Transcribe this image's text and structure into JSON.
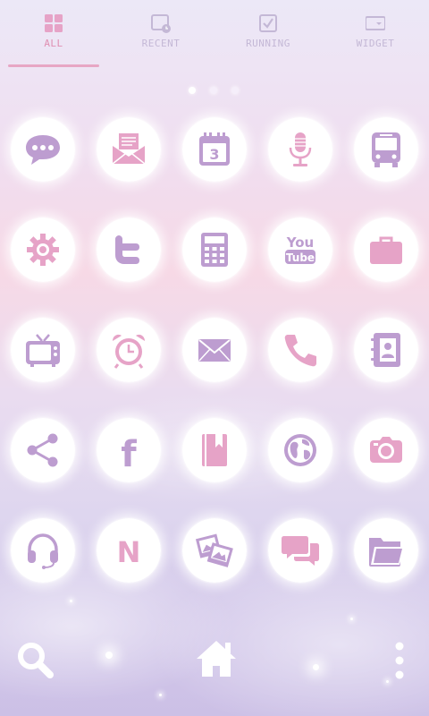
{
  "tabs": [
    {
      "label": "ALL",
      "icon": "grid-icon",
      "active": true
    },
    {
      "label": "RECENT",
      "icon": "recent-icon",
      "active": false
    },
    {
      "label": "RUNNING",
      "icon": "running-icon",
      "active": false
    },
    {
      "label": "WIDGET",
      "icon": "widget-icon",
      "active": false
    }
  ],
  "pager": {
    "pages": 3,
    "current": 1
  },
  "apps": [
    {
      "icon": "chat-bubble-icon"
    },
    {
      "icon": "mail-envelope-icon"
    },
    {
      "icon": "calendar-icon",
      "text": "3"
    },
    {
      "icon": "microphone-icon"
    },
    {
      "icon": "bus-icon"
    },
    {
      "icon": "gear-icon"
    },
    {
      "icon": "twitter-icon"
    },
    {
      "icon": "calculator-icon"
    },
    {
      "icon": "youtube-icon",
      "text": "You",
      "text2": "Tube"
    },
    {
      "icon": "briefcase-icon"
    },
    {
      "icon": "tv-icon"
    },
    {
      "icon": "alarm-clock-icon"
    },
    {
      "icon": "email-icon"
    },
    {
      "icon": "phone-icon"
    },
    {
      "icon": "contacts-icon"
    },
    {
      "icon": "share-icon"
    },
    {
      "icon": "facebook-icon",
      "text": "f"
    },
    {
      "icon": "book-icon"
    },
    {
      "icon": "globe-icon"
    },
    {
      "icon": "camera-icon"
    },
    {
      "icon": "headset-icon"
    },
    {
      "icon": "naver-icon",
      "text": "N"
    },
    {
      "icon": "gallery-icon"
    },
    {
      "icon": "messages-icon"
    },
    {
      "icon": "folder-icon"
    }
  ],
  "dock": {
    "left": "search-icon",
    "center": "home-icon",
    "right": "more-menu-icon"
  },
  "colors": {
    "icon": "#bd9dd0",
    "accent": "#e08fb2",
    "icon_pink": "#e6a3c7"
  }
}
